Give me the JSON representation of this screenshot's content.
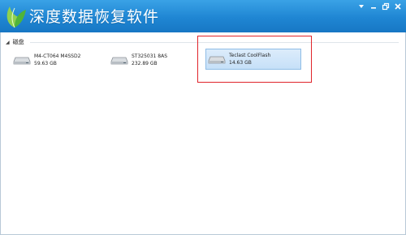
{
  "app": {
    "title": "深度数据恢复软件"
  },
  "group": {
    "label": "磁盘",
    "toggle": "◢"
  },
  "disks": [
    {
      "name": "M4-CT064 M4SSD2",
      "size": "59.63 GB"
    },
    {
      "name": "ST325031 8AS",
      "size": "232.89 GB"
    },
    {
      "name": "Teclast CoolFlash",
      "size": "14.63 GB"
    }
  ],
  "colors": {
    "titlebar": "#1f86d3",
    "selection": "#c6e0f8",
    "highlight": "#e0242a"
  },
  "icons": {
    "logo": "leaf-logo-icon",
    "disk": "hard-disk-icon"
  },
  "window_controls": [
    "menu-icon",
    "minimize-icon",
    "restore-icon",
    "close-icon"
  ]
}
